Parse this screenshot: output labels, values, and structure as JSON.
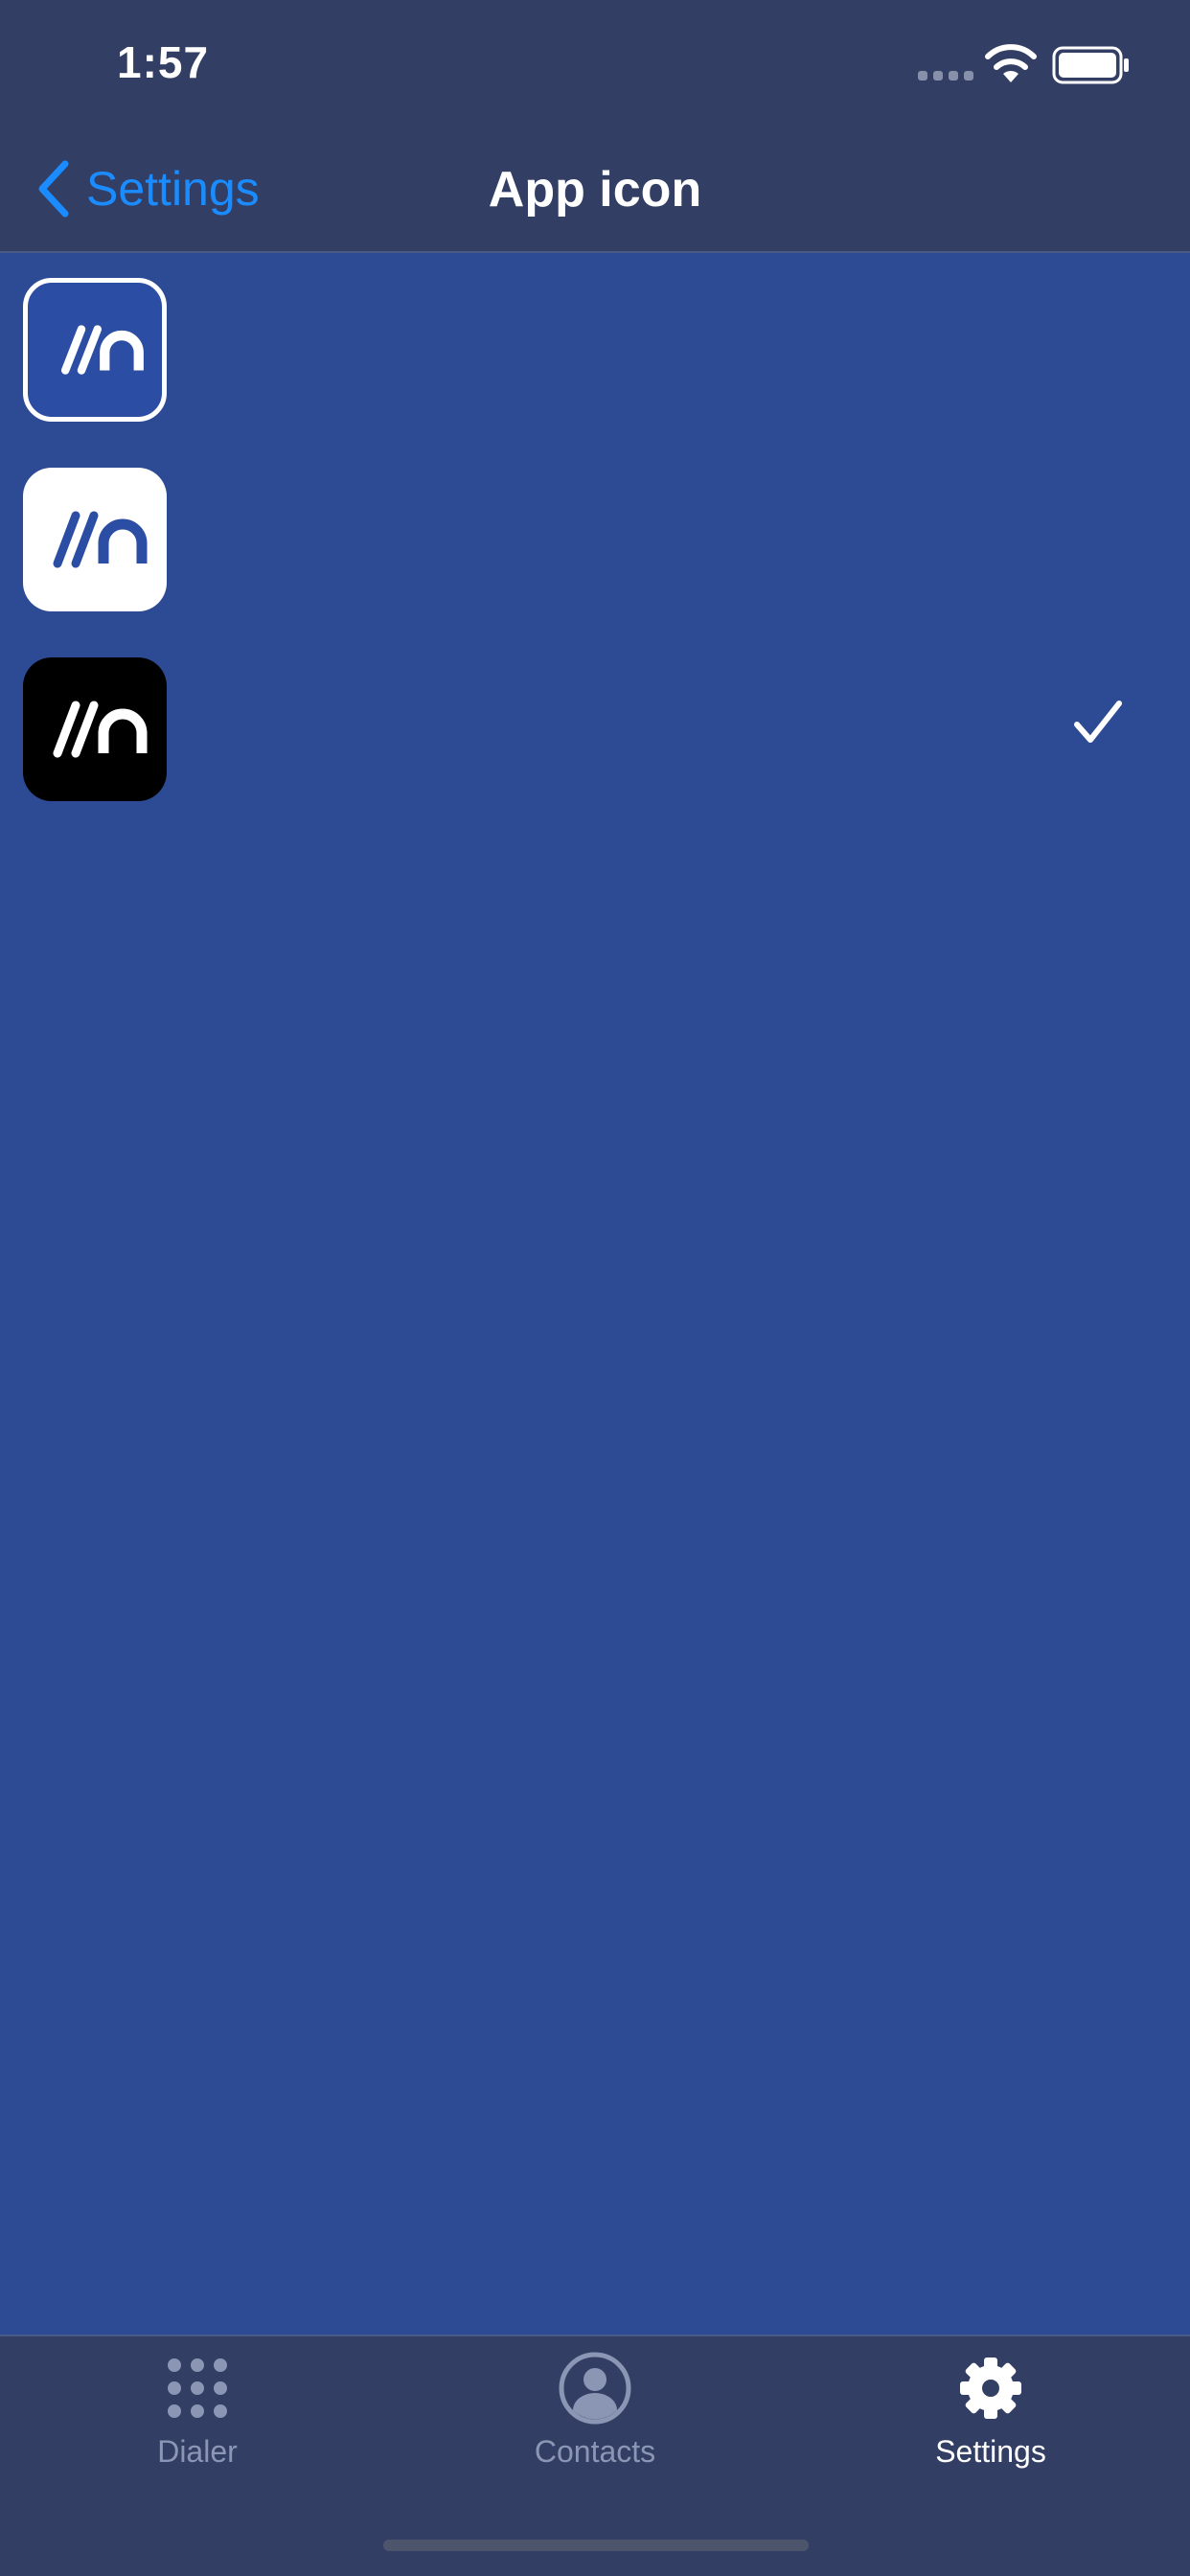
{
  "status_bar": {
    "time": "1:57"
  },
  "nav": {
    "back_label": "Settings",
    "title": "App icon"
  },
  "app_icons": [
    {
      "style": "blue",
      "background": "#2b4da3",
      "glyph_color": "#ffffff",
      "selected": false
    },
    {
      "style": "white",
      "background": "#ffffff",
      "glyph_color": "#2b4da3",
      "selected": false
    },
    {
      "style": "black",
      "background": "#000000",
      "glyph_color": "#ffffff",
      "selected": true
    }
  ],
  "tabs": [
    {
      "label": "Dialer",
      "icon": "dialpad-grid-icon",
      "active": false
    },
    {
      "label": "Contacts",
      "icon": "person-circle-icon",
      "active": false
    },
    {
      "label": "Settings",
      "icon": "gear-icon",
      "active": true
    }
  ],
  "colors": {
    "background": "#2d4a94",
    "bars": "#323e63",
    "accent": "#1a8cff",
    "inactive_tab": "#8b95b4"
  }
}
